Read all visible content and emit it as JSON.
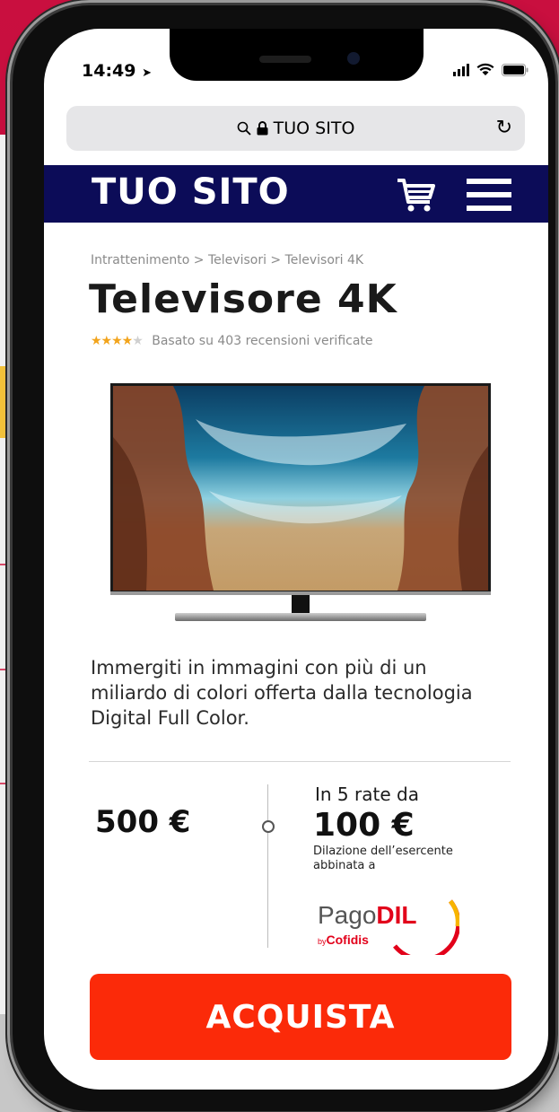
{
  "status_bar": {
    "time": "14:49"
  },
  "browser": {
    "url": "TUO SITO"
  },
  "site": {
    "logo": "TUO SITO"
  },
  "breadcrumb": "Intrattenimento > Televisori > Televisori 4K",
  "product": {
    "title": "Televisore 4K",
    "rating_stars": 4,
    "rating_max": 5,
    "rating_text": "Basato su 403 recensioni verificate",
    "image_icon": "tv-product-image",
    "description": "Immergiti in immagini con più di un miliardo di colori offerta dalla tecnologia Digital Full Color."
  },
  "pricing": {
    "price": "500 €",
    "installment_label": "In 5 rate da",
    "installment_amount": "100 €",
    "installment_note": "Dilazione dell’esercente abbinata a",
    "provider_prefix": "Pago",
    "provider_suffix": "DIL",
    "provider_by_small": "by",
    "provider_by": "Cofidis"
  },
  "cta": {
    "buy_label": "ACQUISTA"
  },
  "colors": {
    "nav": "#0c0c58",
    "cta": "#fb2a09",
    "star": "#f2a41c",
    "brand_red": "#e2001a",
    "background": "#c90f3f"
  }
}
